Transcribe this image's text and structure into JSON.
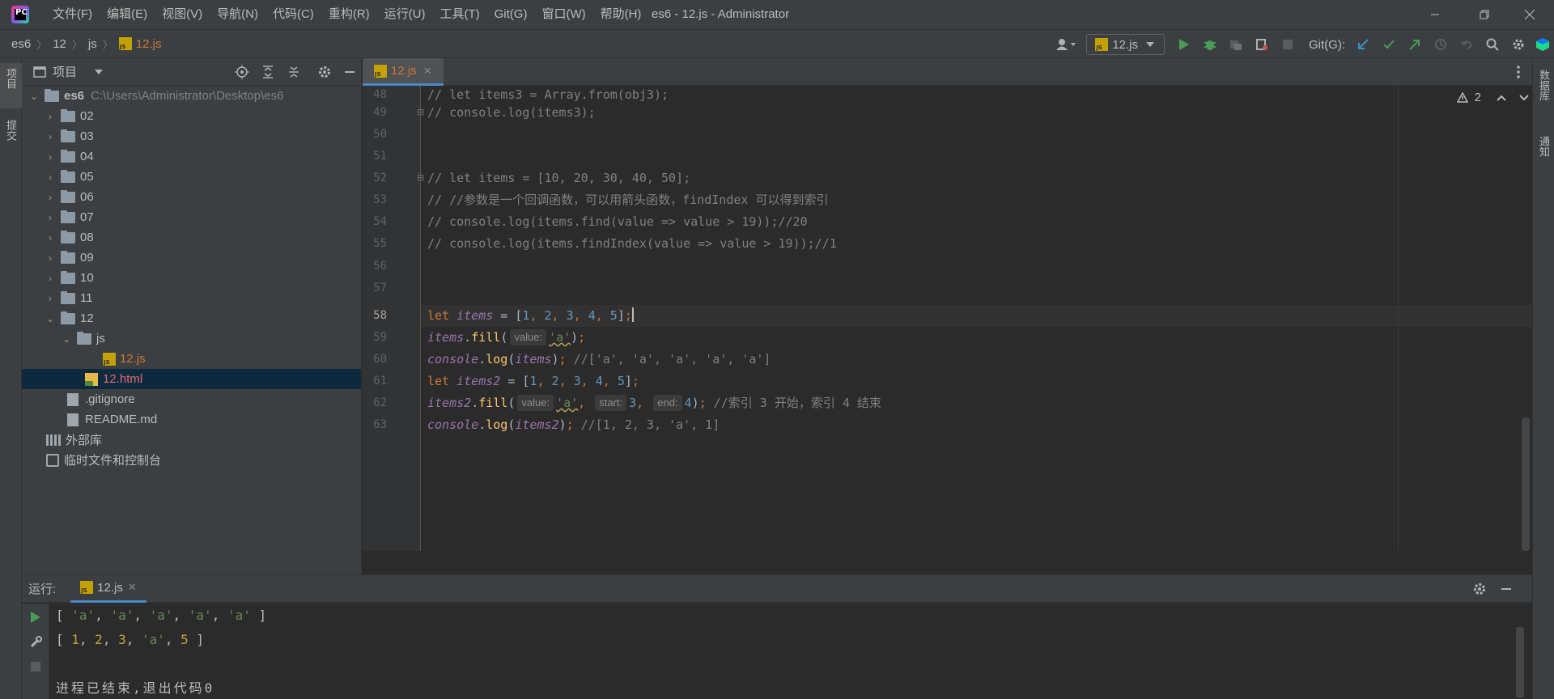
{
  "app": {
    "window_title": "es6 - 12.js - Administrator",
    "menu": [
      "文件(F)",
      "编辑(E)",
      "视图(V)",
      "导航(N)",
      "代码(C)",
      "重构(R)",
      "运行(U)",
      "工具(T)",
      "Git(G)",
      "窗口(W)",
      "帮助(H)"
    ]
  },
  "breadcrumb": [
    "es6",
    "12",
    "js",
    "12.js"
  ],
  "toolbar": {
    "run_config": "12.js",
    "git_label": "Git(G):"
  },
  "left_stripe": [
    "项目",
    "提交"
  ],
  "right_stripe": [
    "数据库",
    "通知"
  ],
  "project": {
    "title": "项目",
    "root_name": "es6",
    "root_path": "C:\\Users\\Administrator\\Desktop\\es6",
    "folders": [
      "02",
      "03",
      "04",
      "05",
      "06",
      "07",
      "08",
      "09",
      "10",
      "11",
      "12"
    ],
    "subfolder": "js",
    "js_file": "12.js",
    "html_file": "12.html",
    "files": [
      ".gitignore",
      "README.md"
    ],
    "external_libs": "外部库",
    "scratches": "临时文件和控制台"
  },
  "editor": {
    "tab_label": "12.js",
    "warnings": "2",
    "lines": [
      {
        "n": "48",
        "text": "// let items3 = Array.from(obj3);"
      },
      {
        "n": "49",
        "text": "// console.log(items3);"
      },
      {
        "n": "50",
        "text": ""
      },
      {
        "n": "51",
        "text": ""
      },
      {
        "n": "52",
        "text": "// let items = [10, 20, 30, 40, 50];"
      },
      {
        "n": "53",
        "text": "// //参数是一个回调函数，可以用箭头函数，findIndex 可以得到索引"
      },
      {
        "n": "54",
        "text": "// console.log(items.find(value => value > 19));//20"
      },
      {
        "n": "55",
        "text": "// console.log(items.findIndex(value => value > 19));//1"
      },
      {
        "n": "56",
        "text": ""
      },
      {
        "n": "57",
        "text": ""
      },
      {
        "n": "58",
        "text": "let items = [1, 2, 3, 4, 5];"
      },
      {
        "n": "59",
        "text": "items.fill( value: 'a');"
      },
      {
        "n": "60",
        "text": "console.log(items); //['a', 'a', 'a', 'a', 'a']"
      },
      {
        "n": "61",
        "text": "let items2 = [1, 2, 3, 4, 5];"
      },
      {
        "n": "62",
        "text": "items2.fill( value: 'a', start: 3, end: 4); //索引 3 开始，索引 4 结束"
      },
      {
        "n": "63",
        "text": "console.log(items2); //[1, 2, 3, 'a', 1]"
      }
    ],
    "hints": {
      "value": "value:",
      "start": "start:",
      "end": "end:"
    },
    "comments": {
      "c60": "//['a', 'a', 'a', 'a', 'a']",
      "c62": "//索引 3 开始，索引 4 结束",
      "c63": "//[1, 2, 3, 'a', 1]"
    }
  },
  "run": {
    "label": "运行:",
    "tab": "12.js",
    "output": [
      "[ 'a', 'a', 'a', 'a', 'a' ]",
      "[ 1, 2, 3, 'a', 5 ]",
      "",
      "进程已结束,退出代码0"
    ]
  },
  "colors": {
    "keyword": "#cc7832",
    "variable": "#9876aa",
    "number": "#6897bb",
    "string": "#6a8759",
    "comment": "#808080",
    "selection": "#0d293e",
    "accent": "#4a88c7"
  }
}
